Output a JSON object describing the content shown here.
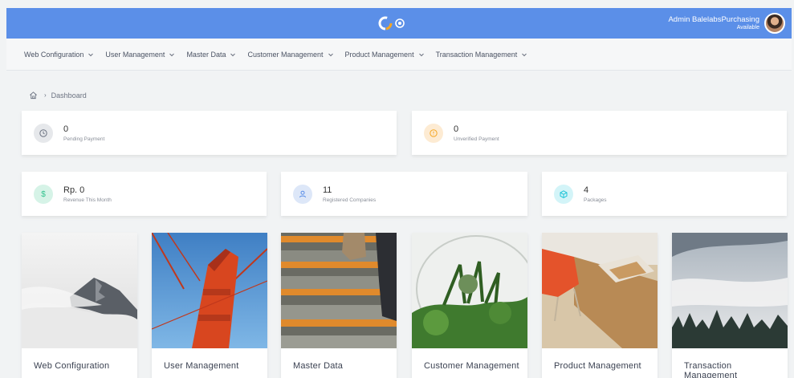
{
  "header": {
    "user_name": "Admin BalelabsPurchasing",
    "user_status": "Available",
    "accent": "#5b8fe8"
  },
  "nav": {
    "items": [
      {
        "label": "Web Configuration"
      },
      {
        "label": "User Management"
      },
      {
        "label": "Master Data"
      },
      {
        "label": "Customer Management"
      },
      {
        "label": "Product Management"
      },
      {
        "label": "Transaction Management"
      }
    ]
  },
  "breadcrumb": {
    "home_icon": "home-icon",
    "current": "Dashboard"
  },
  "stats": [
    {
      "value": "0",
      "label": "Pending Payment",
      "icon": "clock-icon",
      "color": "#9aa0a8"
    },
    {
      "value": "0",
      "label": "Unverified Payment",
      "icon": "alert-circle-icon",
      "color": "#f5a623"
    },
    {
      "value": "Rp. 0",
      "label": "Revenue This Month",
      "icon": "dollar-icon",
      "color": "#34c38f"
    },
    {
      "value": "11",
      "label": "Registered Companies",
      "icon": "user-icon",
      "color": "#5b8fe8"
    },
    {
      "value": "4",
      "label": "Packages",
      "icon": "package-icon",
      "color": "#22c5d8"
    }
  ],
  "tiles": [
    {
      "label": "Web Configuration",
      "image": "misty-mountain-photo"
    },
    {
      "label": "User Management",
      "image": "red-bridge-photo"
    },
    {
      "label": "Master Data",
      "image": "stairs-photo"
    },
    {
      "label": "Customer Management",
      "image": "terrarium-photo"
    },
    {
      "label": "Product Management",
      "image": "desk-chair-photo"
    },
    {
      "label": "Transaction Management",
      "image": "foggy-forest-photo"
    }
  ]
}
